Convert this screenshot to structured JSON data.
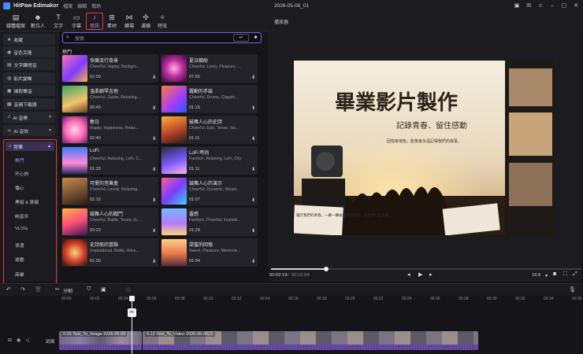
{
  "app": {
    "name": "HitPaw Edimakor",
    "menu": [
      "檔案",
      "編輯",
      "幫助"
    ],
    "project_title": "2026-05-06_01"
  },
  "toolbar": {
    "items": [
      {
        "label": "媒體檔案",
        "icon": "media-icon"
      },
      {
        "label": "數位人",
        "icon": "avatar-icon"
      },
      {
        "label": "文字",
        "icon": "text-icon"
      },
      {
        "label": "字幕",
        "icon": "subtitle-icon"
      },
      {
        "label": "音訊",
        "icon": "music-note-icon",
        "active": true
      },
      {
        "label": "素材",
        "icon": "stickers-icon"
      },
      {
        "label": "轉場",
        "icon": "transition-icon"
      },
      {
        "label": "濾鏡",
        "icon": "filter-icon"
      },
      {
        "label": "特效",
        "icon": "effects-icon"
      }
    ]
  },
  "sidebar": {
    "items": [
      {
        "label": "收藏",
        "icon": "star-icon"
      },
      {
        "label": "音色克隆",
        "icon": "clone-icon"
      },
      {
        "label": "文字轉語音",
        "icon": "tts-icon"
      },
      {
        "label": "影片變聲",
        "icon": "voice-change-icon"
      },
      {
        "label": "擷取聲音",
        "icon": "extract-icon"
      },
      {
        "label": "音頻下載器",
        "icon": "download-icon"
      },
      {
        "label": "AI 音樂",
        "icon": "ai-music-icon",
        "expandable": true
      },
      {
        "label": "AI 音效",
        "icon": "ai-sfx-icon",
        "expandable": true
      }
    ],
    "music": {
      "label": "音樂",
      "subcategories": [
        "熱門",
        "开心的",
        "傷心",
        "黑暗 & 懸疑",
        "純音乐",
        "VLOG",
        "浪漫",
        "遊戲",
        "商業"
      ],
      "active_index": 0
    }
  },
  "search": {
    "placeholder": "搜索",
    "enter_key": "↵"
  },
  "section": {
    "title": "熱門"
  },
  "tracks": [
    {
      "title": "快樂流行背景",
      "tags": "Cheerful, Happy, Backgro...",
      "duration": "01:00"
    },
    {
      "title": "夏日繽紛",
      "tags": "Cheerful, Lively, Pleasure, ...",
      "duration": "07:56"
    },
    {
      "title": "溫柔鋼琴吉他",
      "tags": "Cheerful, Guitar, Relaxing,...",
      "duration": "00:40"
    },
    {
      "title": "躍動的手鼓",
      "tags": "Cheerful, Drums, Clappin...",
      "duration": "01:15"
    },
    {
      "title": "春日",
      "tags": "Happy, Happiness, Relax...",
      "duration": "02:40"
    },
    {
      "title": "鼓舞人心的史詩",
      "tags": "Cheerful, Epic, Tense, Ins...",
      "duration": "01:11"
    },
    {
      "title": "LoFi",
      "tags": "Cheerful, Relaxing, LoFi, C...",
      "duration": "01:33"
    },
    {
      "title": "LoFi 時尚",
      "tags": "Fashion, Relaxing, LoFi, City",
      "duration": "01:11"
    },
    {
      "title": "可愛的音樂盒",
      "tags": "Cheerful, Lovely, Relaxing...",
      "duration": "01:10"
    },
    {
      "title": "鼓舞人心的演示",
      "tags": "Cheerful, Dynamic, Relaxi...",
      "duration": "01:07"
    },
    {
      "title": "鼓舞人心的戰鬥",
      "tags": "Cheerful, Battle, Tense, In...",
      "duration": "03:23"
    },
    {
      "title": "靈感",
      "tags": "Fashion, Cheerful, Inspirat...",
      "duration": "01:28"
    },
    {
      "title": "史詩般的冒險",
      "tags": "Inspirational, Battle, Adve...",
      "duration": "01:30"
    },
    {
      "title": "甜蜜的回憶",
      "tags": "Sweet, Pleasure, Memorie...",
      "duration": "01:04"
    }
  ],
  "player": {
    "title": "播放器",
    "current_time": "00:02:19",
    "total_time": "00:15:04",
    "progress": 0.16,
    "aspect": "16:9",
    "preview": {
      "headline": "畢業影片製作",
      "subtitle": "記錄青春．留住感動",
      "tagline": "回憶會褪色，影像會永遠記得我們的故事。",
      "note": "屬於我們的青春，一幕一幕被保存的美好，由我們一起完成。"
    }
  },
  "timeline": {
    "split_label": "分割",
    "ruler_ticks": [
      "00:00",
      "00:02",
      "00:04",
      "00:06",
      "00:08",
      "00:10",
      "00:12",
      "00:14",
      "00:16",
      "00:18",
      "00:20",
      "00:22",
      "00:24",
      "00:26",
      "00:28",
      "00:30",
      "00:32",
      "00:34",
      "00:36"
    ],
    "track_label": "封面",
    "clips": [
      {
        "label": "0:03 Text_To_Image-2026-05-06"
      },
      {
        "label": "0:12 Text_To_Video-2026-05-06(2)"
      }
    ]
  },
  "colors": {
    "accent": "#7a5cff",
    "highlight_border": "#e23b3b",
    "background": "#151519"
  }
}
